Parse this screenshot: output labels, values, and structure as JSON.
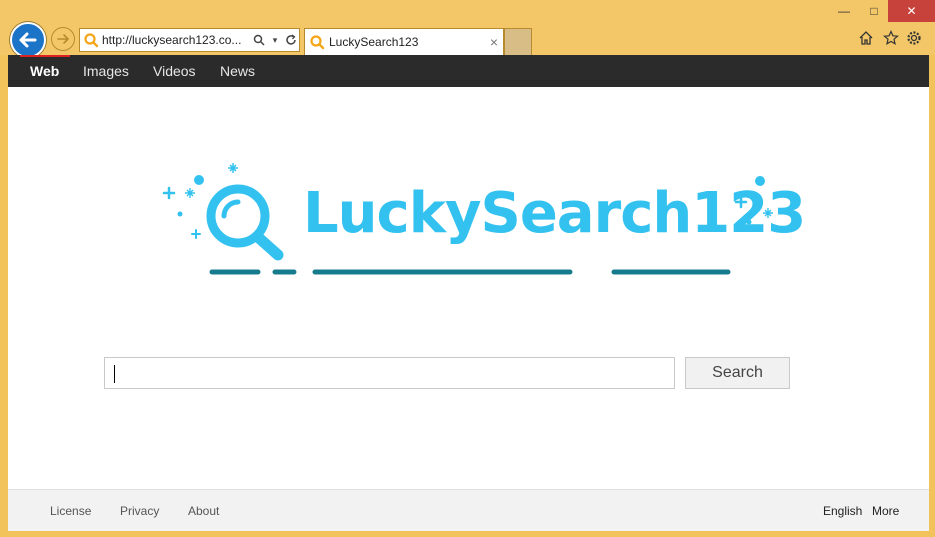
{
  "browser": {
    "address_url": "http://luckysearch123.co...",
    "tab_title": "LuckySearch123",
    "tab_close": "×",
    "win_min": "—",
    "win_max": "□",
    "win_close": "✕"
  },
  "nav": {
    "items": [
      {
        "label": "Web",
        "active": true
      },
      {
        "label": "Images"
      },
      {
        "label": "Videos"
      },
      {
        "label": "News"
      }
    ]
  },
  "logo": {
    "text": "LuckySearch123",
    "color": "#33c2ef",
    "underline_color": "#177b8e"
  },
  "search": {
    "input_value": "",
    "button_label": "Search"
  },
  "footer": {
    "links": [
      "License",
      "Privacy",
      "About"
    ],
    "right": [
      "English",
      "More"
    ]
  },
  "colors": {
    "chrome": "#f3c768",
    "navbar": "#2b2b2b",
    "active_underline": "#dd2222",
    "back_button": "#1b74c7"
  }
}
